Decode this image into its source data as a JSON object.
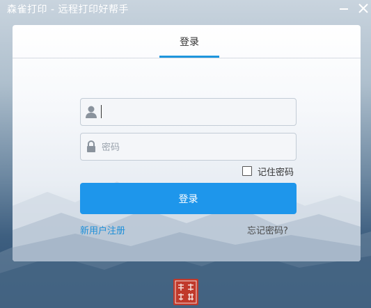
{
  "window": {
    "title": "森雀打印 - 远程打印好帮手",
    "minimize_icon": "minimize-icon",
    "close_icon": "close-icon"
  },
  "login": {
    "tab_label": "登录",
    "username": {
      "value": "",
      "icon": "user-icon"
    },
    "password": {
      "placeholder": "密码",
      "icon": "lock-icon"
    },
    "remember_label": "记住密码",
    "remember_checked": false,
    "submit_label": "登录",
    "register_link": "新用户注册",
    "forgot_link": "忘记密码?"
  },
  "footer": {
    "seal": "森雀打印",
    "seal_icon": "logo-seal-icon"
  },
  "colors": {
    "accent": "#1e96eb",
    "link": "#1e8fd8",
    "seal": "#c0392b"
  }
}
